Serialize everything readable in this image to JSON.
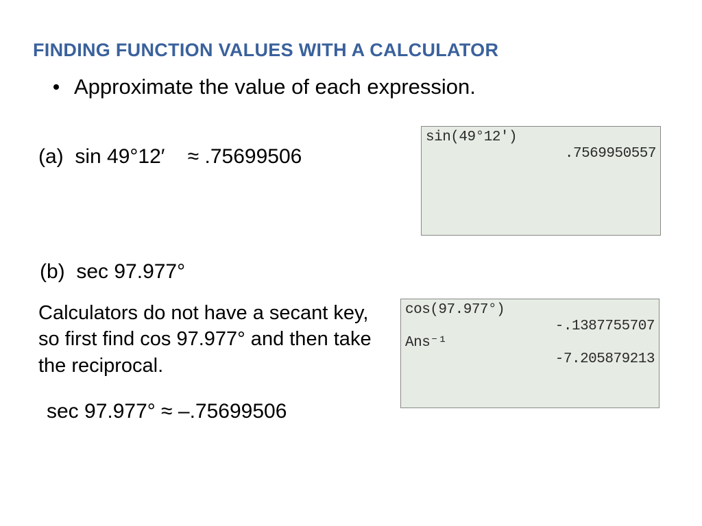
{
  "title": "FINDING FUNCTION VALUES WITH A CALCULATOR",
  "bullet": "Approximate the value of each expression.",
  "a": {
    "label": "(a)",
    "expr": "sin 49°12′",
    "approx": "≈ .75699506"
  },
  "b": {
    "label": "(b)",
    "expr": "sec 97.977°"
  },
  "explain": "Calculators do not have a secant key, so first find cos 97.977° and then take the reciprocal.",
  "result_b": "sec 97.977° ≈ –.75699506",
  "calc_a": {
    "line1": "sin(49°12')",
    "line2": ".7569950557"
  },
  "calc_b": {
    "line1": "cos(97.977°)",
    "line2": "-.1387755707",
    "line3": "Ans⁻¹",
    "line4": "-7.205879213"
  }
}
